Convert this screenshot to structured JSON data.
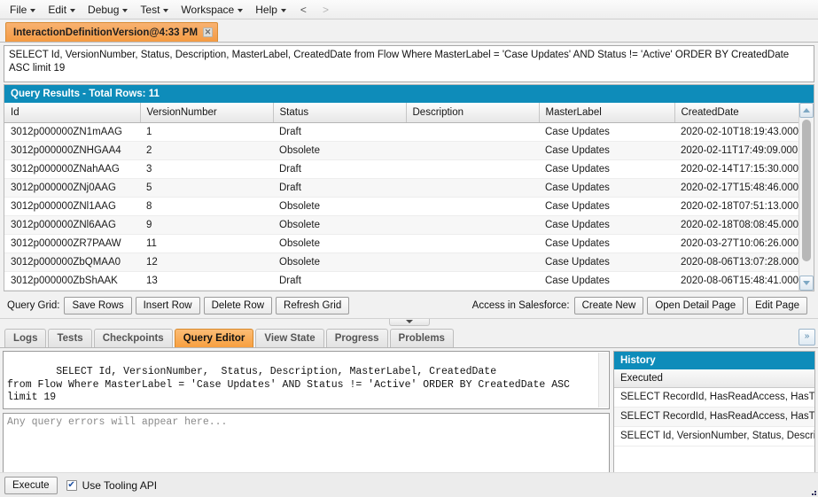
{
  "menubar": {
    "items": [
      {
        "label": "File",
        "has_caret": true
      },
      {
        "label": "Edit",
        "has_caret": true
      },
      {
        "label": "Debug",
        "has_caret": true
      },
      {
        "label": "Test",
        "has_caret": true
      },
      {
        "label": "Workspace",
        "has_caret": true
      },
      {
        "label": "Help",
        "has_caret": true
      }
    ],
    "nav_back": "<",
    "nav_forward": ">"
  },
  "doc_tab": {
    "label": "InteractionDefinitionVersion@4:33 PM",
    "close": "✕"
  },
  "query_display": {
    "text": "SELECT Id, VersionNumber, Status, Description, MasterLabel, CreatedDate from Flow Where MasterLabel = 'Case Updates' AND Status != 'Active' ORDER BY CreatedDate ASC limit 19"
  },
  "results": {
    "header": "Query Results - Total Rows: 11",
    "columns": [
      "Id",
      "VersionNumber",
      "Status",
      "Description",
      "MasterLabel",
      "CreatedDate"
    ],
    "rows": [
      [
        "3012p000000ZN1mAAG",
        "1",
        "Draft",
        "",
        "Case Updates",
        "2020-02-10T18:19:43.000..."
      ],
      [
        "3012p000000ZNHGAA4",
        "2",
        "Obsolete",
        "",
        "Case Updates",
        "2020-02-11T17:49:09.000..."
      ],
      [
        "3012p000000ZNahAAG",
        "3",
        "Draft",
        "",
        "Case Updates",
        "2020-02-14T17:15:30.000..."
      ],
      [
        "3012p000000ZNj0AAG",
        "5",
        "Draft",
        "",
        "Case Updates",
        "2020-02-17T15:48:46.000..."
      ],
      [
        "3012p000000ZNl1AAG",
        "8",
        "Obsolete",
        "",
        "Case Updates",
        "2020-02-18T07:51:13.000..."
      ],
      [
        "3012p000000ZNl6AAG",
        "9",
        "Obsolete",
        "",
        "Case Updates",
        "2020-02-18T08:08:45.000..."
      ],
      [
        "3012p000000ZR7PAAW",
        "11",
        "Obsolete",
        "",
        "Case Updates",
        "2020-03-27T10:06:26.000..."
      ],
      [
        "3012p000000ZbQMAA0",
        "12",
        "Obsolete",
        "",
        "Case Updates",
        "2020-08-06T13:07:28.000..."
      ],
      [
        "3012p000000ZbShAAK",
        "13",
        "Draft",
        "",
        "Case Updates",
        "2020-08-06T15:48:41.000..."
      ]
    ]
  },
  "gridbar": {
    "label": "Query Grid:",
    "buttons": [
      "Save Rows",
      "Insert Row",
      "Delete Row",
      "Refresh Grid"
    ],
    "access_label": "Access in Salesforce:",
    "access_buttons": [
      "Create New",
      "Open Detail Page",
      "Edit Page"
    ]
  },
  "bottom_tabs": {
    "items": [
      "Logs",
      "Tests",
      "Checkpoints",
      "Query Editor",
      "View State",
      "Progress",
      "Problems"
    ],
    "active": "Query Editor",
    "collapse_icon": "»"
  },
  "editor": {
    "soql": "SELECT Id, VersionNumber,  Status, Description, MasterLabel, CreatedDate\nfrom Flow Where MasterLabel = 'Case Updates' AND Status != 'Active' ORDER BY CreatedDate ASC\nlimit 19",
    "errors_placeholder": "Any query errors will appear here..."
  },
  "history": {
    "title": "History",
    "column_header": "Executed",
    "items": [
      "SELECT RecordId, HasReadAccess, HasTr...",
      "SELECT RecordId, HasReadAccess, HasTr...",
      "SELECT Id, VersionNumber, Status, Descri..."
    ]
  },
  "footer": {
    "execute_label": "Execute",
    "tooling_label": "Use Tooling API",
    "tooling_checked": true,
    "check_glyph": "✔"
  },
  "colors": {
    "accent": "#0e8cba",
    "tab_active": "#f79f3f",
    "window_bg": "#f1f1f1"
  }
}
